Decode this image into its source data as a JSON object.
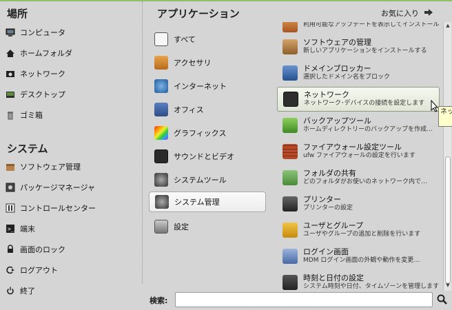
{
  "places": {
    "title": "場所",
    "items": [
      {
        "label": "コンピュータ",
        "icon": "computer-icon"
      },
      {
        "label": "ホームフォルダ",
        "icon": "home-icon"
      },
      {
        "label": "ネットワーク",
        "icon": "network-icon"
      },
      {
        "label": "デスクトップ",
        "icon": "desktop-icon"
      },
      {
        "label": "ゴミ箱",
        "icon": "trash-icon"
      }
    ]
  },
  "system": {
    "title": "システム",
    "items": [
      {
        "label": "ソフトウェア管理",
        "icon": "software-manager-icon"
      },
      {
        "label": "パッケージマネージャ",
        "icon": "package-manager-icon"
      },
      {
        "label": "コントロールセンター",
        "icon": "control-center-icon"
      },
      {
        "label": "端末",
        "icon": "terminal-icon"
      },
      {
        "label": "画面のロック",
        "icon": "lock-icon"
      },
      {
        "label": "ログアウト",
        "icon": "logout-icon"
      },
      {
        "label": "終了",
        "icon": "power-icon"
      }
    ]
  },
  "applications": {
    "title": "アプリケーション",
    "favorites_label": "お気に入り",
    "categories": [
      {
        "label": "すべて",
        "icon": "all-apps-icon",
        "color": "#f4f4f4"
      },
      {
        "label": "アクセサリ",
        "icon": "accessories-icon",
        "color": "#d58a2c"
      },
      {
        "label": "インターネット",
        "icon": "internet-icon",
        "color": "#2e6fb0"
      },
      {
        "label": "オフィス",
        "icon": "office-icon",
        "color": "#3a5e9c"
      },
      {
        "label": "グラフィックス",
        "icon": "graphics-icon",
        "color": "#c04a8a"
      },
      {
        "label": "サウンドとビデオ",
        "icon": "sound-video-icon",
        "color": "#333333"
      },
      {
        "label": "システムツール",
        "icon": "system-tools-icon",
        "color": "#555555"
      },
      {
        "label": "システム管理",
        "icon": "system-admin-icon",
        "color": "#555555"
      },
      {
        "label": "設定",
        "icon": "settings-icon",
        "color": "#888888"
      }
    ],
    "selected_category": "システム管理"
  },
  "apps": [
    {
      "name": "",
      "desc": "利用可能なアップデートを表示してインストール",
      "icon": "update-manager-icon",
      "color": "#c0703a"
    },
    {
      "name": "ソフトウェアの管理",
      "desc": "新しいアプリケーションをインストールする",
      "icon": "software-box-icon",
      "color": "#b5834b"
    },
    {
      "name": "ドメインブロッカー",
      "desc": "選択したドメイン名をブロック",
      "icon": "domain-blocker-icon",
      "color": "#2d5a95"
    },
    {
      "name": "ネットワーク",
      "desc": "ネットワーク･デバイスの接続を設定します",
      "icon": "network-icon",
      "color": "#3a3a3a"
    },
    {
      "name": "バックアップツール",
      "desc": "ホームディレクトリーのバックアップを作成…",
      "icon": "backup-icon",
      "color": "#5aa03a"
    },
    {
      "name": "ファイアウォール設定ツール",
      "desc": "ufw ファイアウォールの設定を行います",
      "icon": "firewall-icon",
      "color": "#b04a2a"
    },
    {
      "name": "フォルダの共有",
      "desc": "どのフォルダがお使いのネットワーク内で…",
      "icon": "folder-share-icon",
      "color": "#5c9a4a"
    },
    {
      "name": "プリンター",
      "desc": "プリンターの設定",
      "icon": "printer-icon",
      "color": "#444444"
    },
    {
      "name": "ユーザとグループ",
      "desc": "ユーザやグループの追加と削除を行います",
      "icon": "users-groups-icon",
      "color": "#d8a020"
    },
    {
      "name": "ログイン画面",
      "desc": "MDM ログイン画面の外観や動作を変更…",
      "icon": "login-screen-icon",
      "color": "#5a7ab0"
    },
    {
      "name": "時刻と日付の設定",
      "desc": "システム時刻や日付、タイムゾーンを管理します",
      "icon": "time-date-icon",
      "color": "#444444"
    }
  ],
  "selected_app": "ネットワーク",
  "tooltip": "ネットワーク",
  "search": {
    "label": "検索:",
    "value": "",
    "placeholder": ""
  }
}
